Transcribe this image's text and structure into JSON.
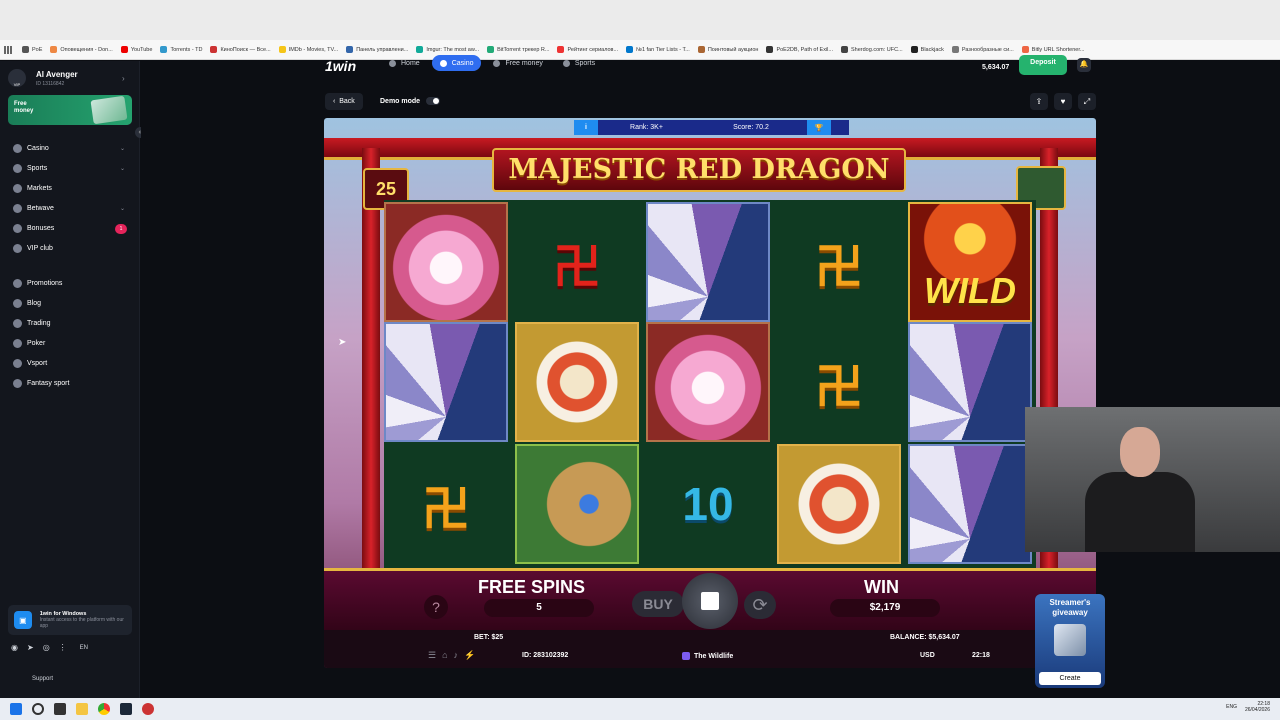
{
  "bookmarks": [
    "PoE",
    "Оповещения - Don...",
    "YouTube",
    "Torrents - TD",
    "КиноПоиск — Все...",
    "IMDb - Movies, TV...",
    "Панель управлени...",
    "Imgur: The most aw...",
    "BitTorrent трекер R...",
    "Рейтинг сериалов...",
    "№1 fan Tier Lists - T...",
    "Поинтовый аукцион",
    "PoE2DB, Path of Exil...",
    "Sherdog.com: UFC...",
    "Blackjack",
    "Разнообразные си...",
    "Bitly URL Shortener..."
  ],
  "user": {
    "name": "Al Avenger",
    "id": "ID 13116842",
    "vip": "VIP"
  },
  "promo": {
    "label": "Free money"
  },
  "nav": [
    {
      "label": "Casino",
      "caret": true
    },
    {
      "label": "Sports",
      "caret": true
    },
    {
      "label": "Markets"
    },
    {
      "label": "Betwave",
      "caret": true
    },
    {
      "label": "Bonuses",
      "badge": "1"
    },
    {
      "label": "VIP club"
    }
  ],
  "nav2": [
    "Promotions",
    "Blog",
    "Trading",
    "Poker",
    "Vsport",
    "Fantasy sport"
  ],
  "app": {
    "title": "1win for Windows",
    "subtitle": "Instant access to the platform with our app"
  },
  "lang": "EN",
  "support": "Support",
  "header": {
    "logo": "1win",
    "tabs": [
      "Home",
      "Casino",
      "Free money",
      "Sports"
    ],
    "active_tab": "Casino",
    "balance": "5,634.07",
    "deposit": "Deposit"
  },
  "game_bar": {
    "back": "Back",
    "demo": "Demo mode"
  },
  "rank": {
    "info": "i",
    "rank": "Rank: 3K+",
    "score": "Score: 70.2"
  },
  "game": {
    "title": "MAJESTIC RED DRAGON",
    "counter": "25",
    "reels": [
      [
        "lotus",
        "fan",
        "glyph"
      ],
      [
        "glyph-red",
        "koi",
        "scroll"
      ],
      [
        "fan",
        "lotus",
        "ten"
      ],
      [
        "glyph",
        "glyph",
        "koi"
      ],
      [
        "wild",
        "fan",
        "fan"
      ]
    ],
    "glyph_text": "卍",
    "glyph_red_text": "卍",
    "ten_text": "10",
    "wild_text": "WILD",
    "free_spins_label": "FREE SPINS",
    "free_spins_value": "5",
    "win_label": "WIN",
    "win_value": "$2,179",
    "buy_label": "BUY",
    "help": "?",
    "bet": "BET: $25",
    "balance": "BALANCE: $5,634.07",
    "round_id": "ID: 283102392",
    "provider": "The Wildlife",
    "currency": "USD",
    "time": "22:18"
  },
  "giveaway": {
    "title": "Streamer's giveaway",
    "button": "Create"
  },
  "taskbar": {
    "lang": "ENG",
    "time": "22:18",
    "date": "26/04/2026"
  }
}
